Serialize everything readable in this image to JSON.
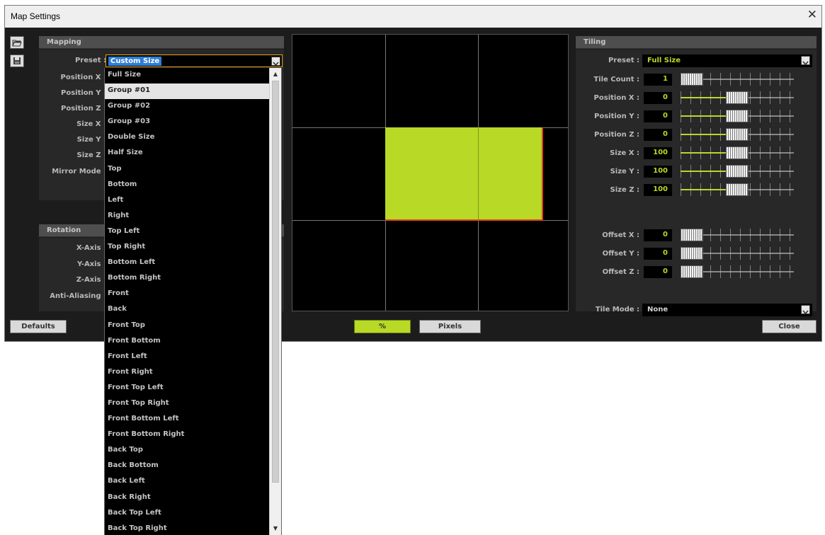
{
  "window": {
    "title": "Map Settings",
    "close_glyph": "✕"
  },
  "toolbar": {
    "open_icon": "folder-open-icon",
    "save_icon": "save-icon"
  },
  "mapping": {
    "header": "Mapping",
    "preset_label": "Preset :",
    "preset_value": "Custom Size",
    "rows": [
      "Position X :",
      "Position Y :",
      "Position Z :",
      "Size X :",
      "Size Y :",
      "Size Z :",
      "Mirror Mode :"
    ]
  },
  "rotation": {
    "header": "Rotation",
    "rows": [
      "X-Axis :",
      "Y-Axis :",
      "Z-Axis :",
      "Anti-Aliasing :"
    ]
  },
  "dropdown": {
    "highlighted_index": 1,
    "items": [
      "Full Size",
      "Group #01",
      "Group #02",
      "Group #03",
      "Double Size",
      "Half Size",
      "Top",
      "Bottom",
      "Left",
      "Right",
      "Top Left",
      "Top Right",
      "Bottom Left",
      "Bottom Right",
      "Front",
      "Back",
      "Front Top",
      "Front Bottom",
      "Front Left",
      "Front Right",
      "Front Top Left",
      "Front Top Right",
      "Front Bottom Left",
      "Front Bottom Right",
      "Back Top",
      "Back Bottom",
      "Back Left",
      "Back Right",
      "Back Top Left",
      "Back Top Right"
    ]
  },
  "preview": {
    "target_color": "#b8d926",
    "edge_color": "#e3401a"
  },
  "bottom": {
    "defaults": "Defaults",
    "percent": "%",
    "pixels": "Pixels",
    "close": "Close"
  },
  "tiling": {
    "header": "Tiling",
    "preset_label": "Preset :",
    "preset_value": "Full Size",
    "rows": [
      {
        "label": "Tile Count :",
        "value": "1",
        "level": 0.0
      },
      {
        "label": "Position X :",
        "value": "0",
        "level": 0.5
      },
      {
        "label": "Position Y :",
        "value": "0",
        "level": 0.5
      },
      {
        "label": "Position Z :",
        "value": "0",
        "level": 0.5
      },
      {
        "label": "Size X :",
        "value": "100",
        "level": 0.5
      },
      {
        "label": "Size Y :",
        "value": "100",
        "level": 0.5
      },
      {
        "label": "Size Z :",
        "value": "100",
        "level": 0.5
      }
    ],
    "offsets": [
      {
        "label": "Offset X :",
        "value": "0",
        "level": 0.0
      },
      {
        "label": "Offset Y :",
        "value": "0",
        "level": 0.0
      },
      {
        "label": "Offset Z :",
        "value": "0",
        "level": 0.0
      }
    ],
    "tile_mode_label": "Tile Mode :",
    "tile_mode_value": "None"
  },
  "colors": {
    "accent": "#b8d926",
    "selection": "#2f7ed8",
    "panel": "#282828"
  }
}
